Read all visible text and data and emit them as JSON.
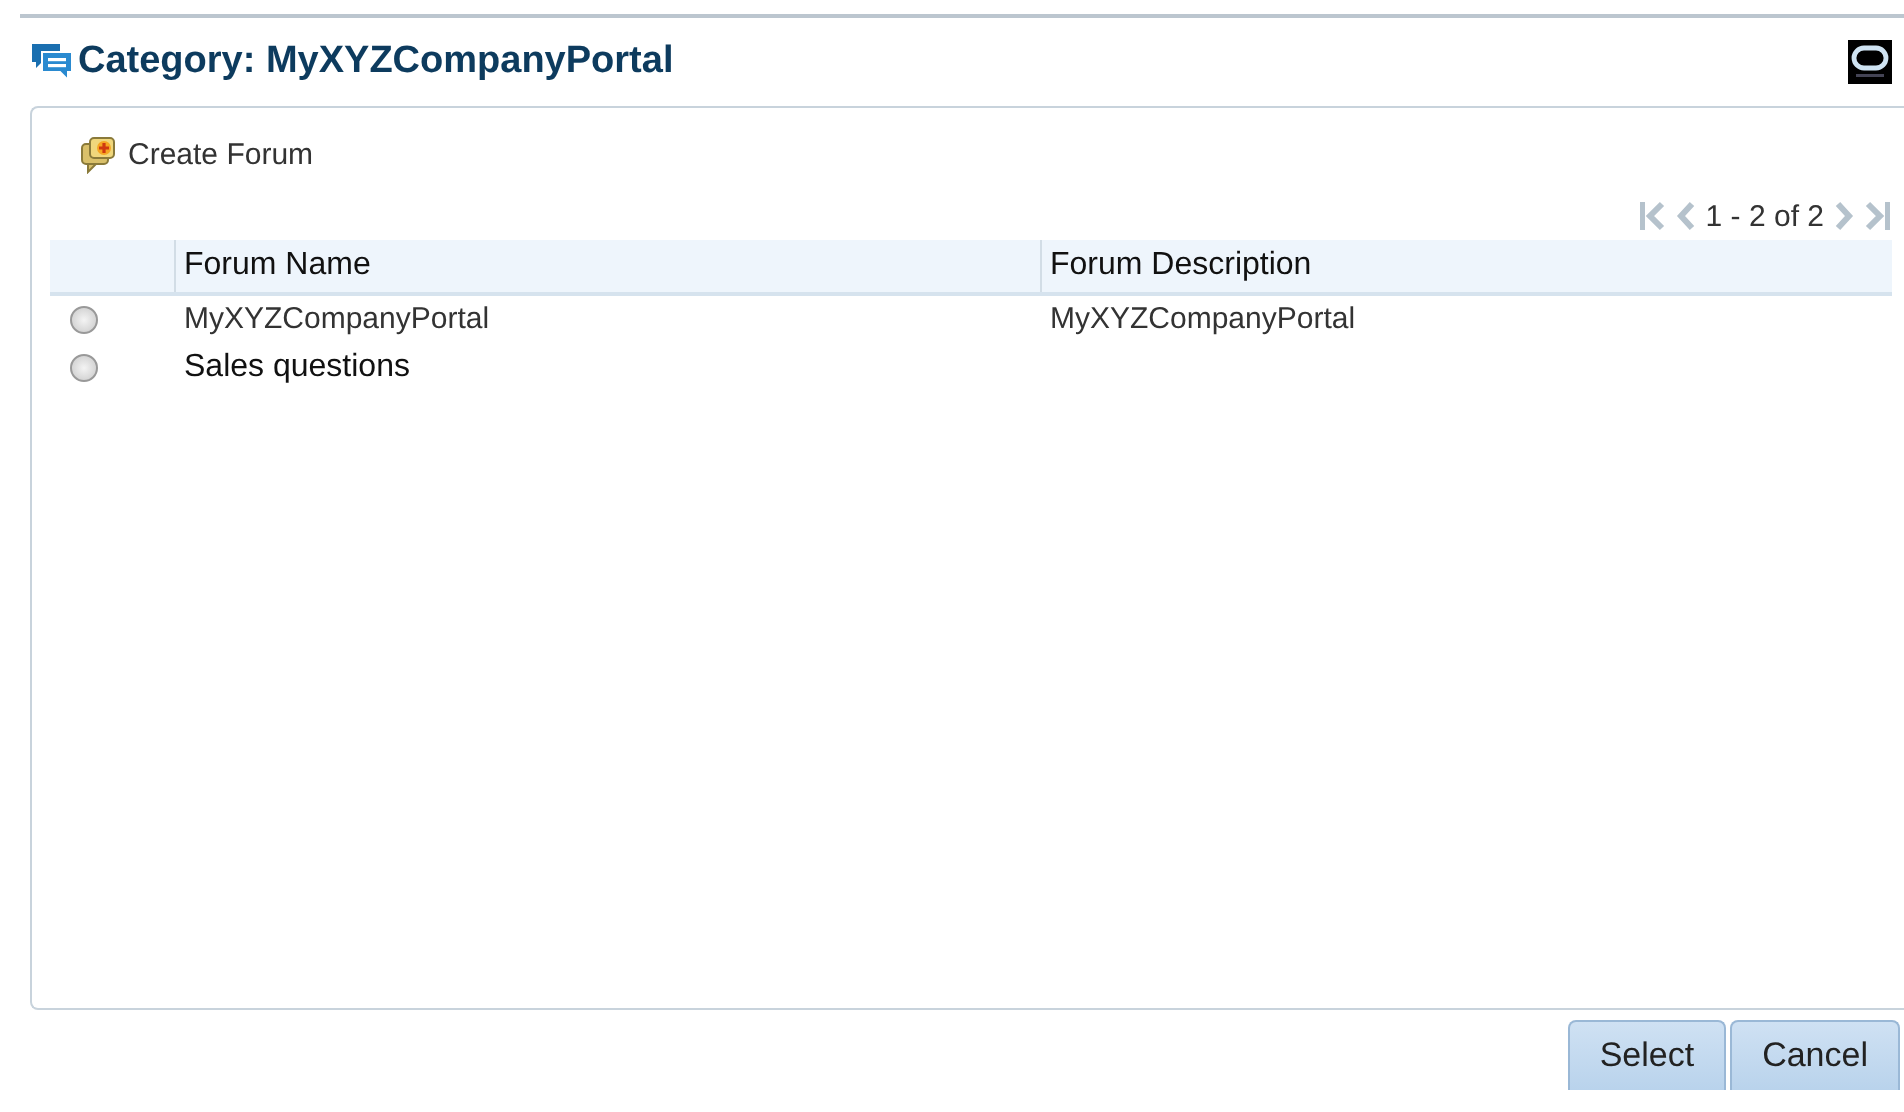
{
  "dialog": {
    "title": "Category: MyXYZCompanyPortal"
  },
  "toolbar": {
    "create_label": "Create Forum"
  },
  "pagination": {
    "range": "1 - 2 of 2"
  },
  "table": {
    "columns": [
      "Forum Name",
      "Forum Description"
    ],
    "rows": [
      {
        "name": "MyXYZCompanyPortal",
        "description": "MyXYZCompanyPortal",
        "selected": false
      },
      {
        "name": "Sales questions",
        "description": "",
        "selected": false
      }
    ]
  },
  "buttons": [
    "Select",
    "Cancel"
  ]
}
